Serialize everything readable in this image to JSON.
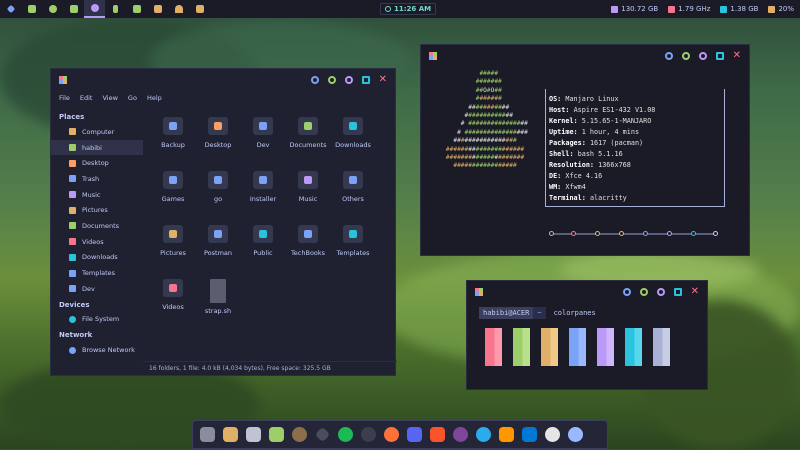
{
  "topbar": {
    "clock": "11:26 AM",
    "disk": "130.72 GB",
    "cpu": "1.79 GHz",
    "ram": "1.38 GB",
    "battery": "20%"
  },
  "thunar": {
    "menu": [
      "File",
      "Edit",
      "View",
      "Go",
      "Help"
    ],
    "places_heading": "Places",
    "places": [
      "Computer",
      "habibi",
      "Desktop",
      "Trash",
      "Music",
      "Pictures",
      "Documents",
      "Videos",
      "Downloads",
      "Templates",
      "Dev"
    ],
    "devices_heading": "Devices",
    "devices": [
      "File System"
    ],
    "network_heading": "Network",
    "network": [
      "Browse Network"
    ],
    "files": [
      "Backup",
      "Desktop",
      "Dev",
      "Documents",
      "Downloads",
      "Games",
      "go",
      "Installer",
      "Music",
      "Others",
      "Pictures",
      "Postman",
      "Public",
      "TechBooks",
      "Templates",
      "Videos",
      "strap.sh"
    ],
    "status": "16 folders, 1 file: 4.0 kB (4,034 bytes), Free space: 325.5 GB"
  },
  "neofetch": {
    "os_label": "OS:",
    "os": "Manjaro Linux",
    "host_label": "Host:",
    "host": "Aspire ES1-432 V1.08",
    "kernel_label": "Kernel:",
    "kernel": "5.15.65-1-MANJARO",
    "uptime_label": "Uptime:",
    "uptime": "1 hour, 4 mins",
    "packages_label": "Packages:",
    "packages": "1617 (pacman)",
    "shell_label": "Shell:",
    "shell": "bash 5.1.16",
    "resolution_label": "Resolution:",
    "resolution": "1366x768",
    "de_label": "DE:",
    "de": "Xfce 4.16",
    "wm_label": "WM:",
    "wm": "Xfwm4",
    "terminal_label": "Terminal:",
    "terminal": "alacritty"
  },
  "colorpanes": {
    "user": "habibi@ACER",
    "path": "~",
    "command": "colorpanes"
  },
  "colors": {
    "accent": "#7aa2f7",
    "pane_red": "#f7768e",
    "pane_green": "#9ece6a",
    "pane_yellow": "#e0af68",
    "pane_blue": "#7aa2f7",
    "pane_purple": "#bb9af7",
    "pane_cyan": "#2ac3de",
    "pane_gray": "#a9b1d6"
  }
}
